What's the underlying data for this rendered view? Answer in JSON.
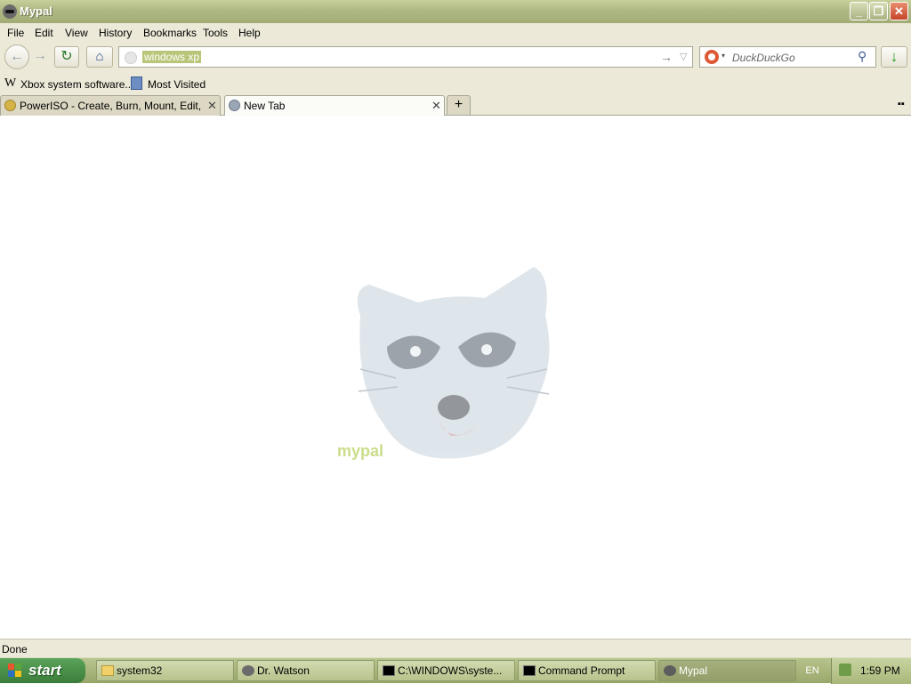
{
  "window": {
    "title": "Mypal",
    "minimize": "_",
    "restore": "❐",
    "close": "✕"
  },
  "menu": [
    "File",
    "Edit",
    "View",
    "History",
    "Bookmarks",
    "Tools",
    "Help"
  ],
  "nav": {
    "back": "←",
    "forward": "→",
    "reload": "↻",
    "home": "⌂",
    "go": "→",
    "dropdown": "▽",
    "download": "↓"
  },
  "urlbar": {
    "value": "windows xp"
  },
  "search": {
    "placeholder": "DuckDuckGo",
    "engine_icon": "duckduckgo-icon",
    "caret": "▾",
    "magnifier": "⚲"
  },
  "bookmarks": [
    {
      "label": "Xbox system software...",
      "icon": "wikipedia-icon",
      "glyph": "W"
    },
    {
      "label": "Most Visited",
      "icon": "most-visited-icon"
    }
  ],
  "tabs": [
    {
      "title": "PowerISO - Create, Burn, Mount, Edit, C...",
      "selected": false,
      "icon": "poweriso-icon"
    },
    {
      "title": "New Tab",
      "selected": true,
      "icon": "globe-icon"
    }
  ],
  "tab_controls": {
    "close": "✕",
    "new_tab": "+",
    "list_all": "▪▪"
  },
  "content": {
    "logo_text": "mypal"
  },
  "status": {
    "text": "Done"
  },
  "taskbar": {
    "start": "start",
    "tasks": [
      {
        "label": "system32",
        "icon": "folder-icon",
        "active": false
      },
      {
        "label": "Dr. Watson",
        "icon": "dr-watson-icon",
        "active": false
      },
      {
        "label": "C:\\WINDOWS\\syste...",
        "icon": "cmd-icon",
        "active": false
      },
      {
        "label": "Command Prompt",
        "icon": "cmd-icon",
        "active": false
      },
      {
        "label": "Mypal",
        "icon": "mypal-icon",
        "active": true
      }
    ],
    "language": "EN",
    "clock": "1:59 PM"
  },
  "colors": {
    "titlebar": "#aeb883",
    "chrome": "#ece9d8",
    "url_highlight": "#b9c67a",
    "taskbar": "#a8b57a"
  }
}
